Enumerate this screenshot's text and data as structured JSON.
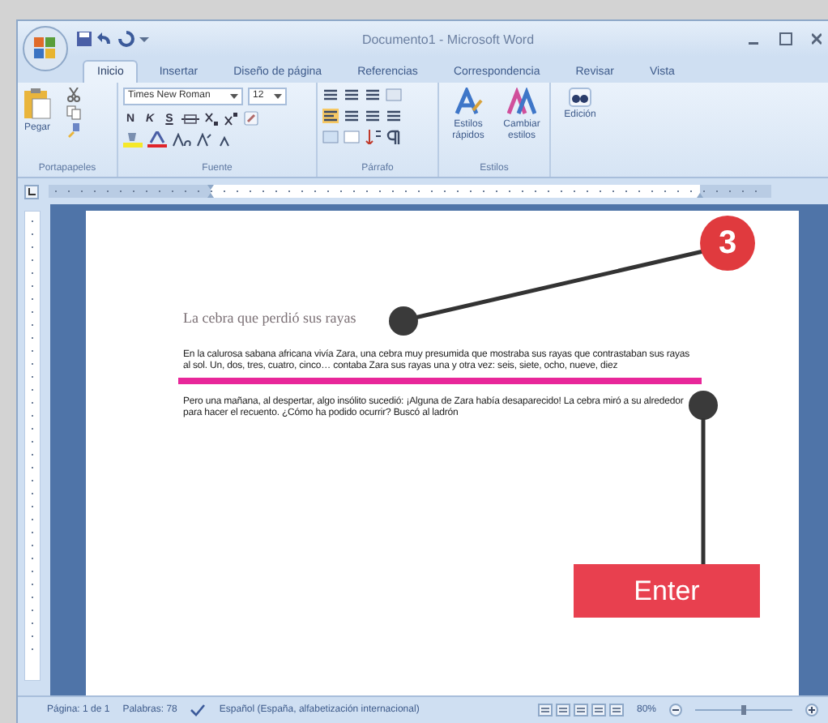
{
  "window": {
    "title": "Documento1 - Microsoft Word"
  },
  "tabs": [
    {
      "label": "Inicio",
      "selected": true
    },
    {
      "label": "Insertar",
      "selected": false
    },
    {
      "label": "Diseño de página",
      "selected": false
    },
    {
      "label": "Referencias",
      "selected": false
    },
    {
      "label": "Correspondencia",
      "selected": false
    },
    {
      "label": "Revisar",
      "selected": false
    },
    {
      "label": "Vista",
      "selected": false
    }
  ],
  "clipboard": {
    "group": "Portapapeles",
    "paste": "Pegar"
  },
  "font": {
    "group": "Fuente",
    "name": "Times New Roman",
    "size": "12",
    "format_buttons": [
      "N",
      "K",
      "S"
    ]
  },
  "paragraph": {
    "group": "Párrafo"
  },
  "styles": {
    "group": "Estilos",
    "buttons": [
      "Estilos rápidos",
      "Cambiar estilos"
    ]
  },
  "editing": {
    "label": "Edición"
  },
  "document": {
    "title": "La cebra que perdió sus rayas",
    "paragraphs": [
      "En la calurosa sabana africana vivía Zara, una cebra muy presumida que mostraba sus rayas que contrastaban sus rayas al sol. Un, dos, tres, cuatro, cinco… contaba Zara sus rayas una y otra vez: seis, siete, ocho, nueve, diez",
      "Pero una mañana, al despertar, algo insólito sucedió: ¡Alguna de Zara había desaparecido! La cebra miró a su alrededor para hacer el recuento. ¿Cómo ha podido ocurrir? Buscó al ladrón"
    ]
  },
  "annotation": {
    "step": "3",
    "key": "Enter"
  },
  "status_bar": {
    "page": "Página: 1 de 1",
    "words": "Palabras: 78",
    "language": "Español (España, alfabetización internacional)",
    "zoom": "80%",
    "zoom_slider": {
      "level": 0.5
    }
  }
}
